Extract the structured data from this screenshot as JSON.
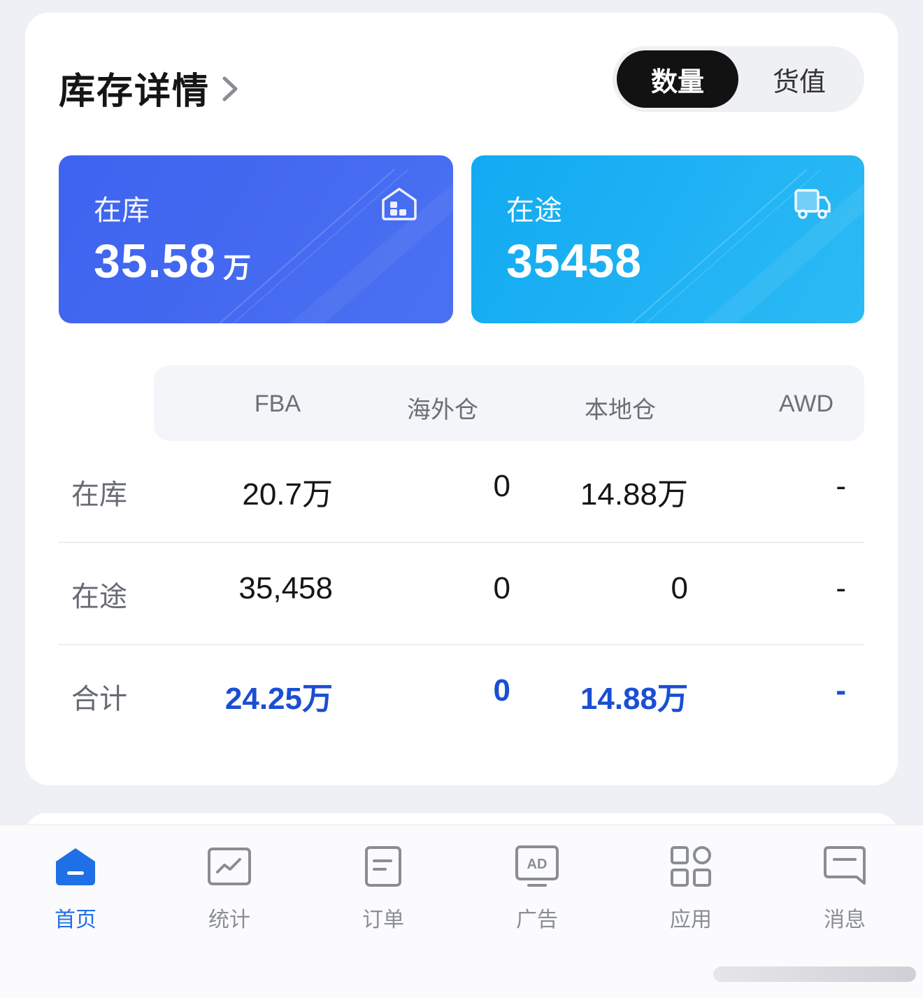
{
  "header": {
    "title": "库存详情"
  },
  "toggle": {
    "options": [
      "数量",
      "货值"
    ],
    "selected": "数量"
  },
  "summary": {
    "onhand": {
      "label": "在库",
      "value": "35.58",
      "unit": "万",
      "icon": "warehouse-icon"
    },
    "transit": {
      "label": "在途",
      "value": "35458",
      "icon": "truck-icon"
    }
  },
  "table": {
    "columns": [
      "FBA",
      "海外仓",
      "本地仓",
      "AWD"
    ],
    "rows": [
      {
        "label": "在库",
        "values": [
          "20.7万",
          "0",
          "14.88万",
          "-"
        ]
      },
      {
        "label": "在途",
        "values": [
          "35,458",
          "0",
          "0",
          "-"
        ]
      },
      {
        "label": "合计",
        "values": [
          "24.25万",
          "0",
          "14.88万",
          "-"
        ]
      }
    ]
  },
  "tabbar": {
    "items": [
      {
        "label": "首页",
        "icon": "home-icon",
        "active": true
      },
      {
        "label": "统计",
        "icon": "chart-icon"
      },
      {
        "label": "订单",
        "icon": "order-icon"
      },
      {
        "label": "广告",
        "icon": "ad-icon"
      },
      {
        "label": "应用",
        "icon": "apps-grid-icon"
      },
      {
        "label": "消息",
        "icon": "message-icon"
      }
    ]
  },
  "colors": {
    "primary": "#1f6fe6",
    "onhand_card": "#3e63ef",
    "transit_card": "#12aaf2",
    "total_text": "#1a4fd3"
  }
}
